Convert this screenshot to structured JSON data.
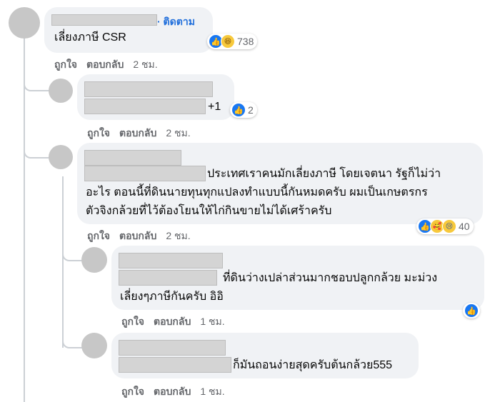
{
  "comments": [
    {
      "follow_label": "· ติดตาม",
      "lines": [
        "เลี่ยงภาษี CSR"
      ],
      "actions": {
        "like": "ถูกใจ",
        "reply": "ตอบกลับ",
        "time": "2 ชม."
      },
      "reaction_icons": [
        "like-icon",
        "haha-icon"
      ],
      "reaction_count": "738",
      "replies": [
        {
          "lines": [
            "+1"
          ],
          "actions": {
            "like": "ถูกใจ",
            "reply": "ตอบกลับ",
            "time": "2 ชม."
          },
          "reaction_icons": [
            "like-icon"
          ],
          "reaction_count": "2"
        },
        {
          "lines": [
            "ประเทศเราคนมักเลี่ยงภาษี โดยเจตนา รัฐก็ไม่ว่า",
            "อะไร ตอนนี้ที่ดินนายทุนทุกแปลงทำแบบนี้กันหมดครับ ผมเป็นเกษตรกร",
            "ตัวจิงกล้วยที่ไว้ต้องโยนให้ไก่กินขายไม่ได้เศร้าครับ"
          ],
          "actions": {
            "like": "ถูกใจ",
            "reply": "ตอบกลับ",
            "time": "2 ชม."
          },
          "reaction_icons": [
            "like-icon",
            "care-icon",
            "sad-icon"
          ],
          "reaction_count": "40",
          "replies": [
            {
              "lines": [
                "ที่ดินว่างเปล่าส่วนมากชอบปลูกกล้วย มะม่วง",
                "เลี่ยงๆภาษีกันครับ อิอิ"
              ],
              "actions": {
                "like": "ถูกใจ",
                "reply": "ตอบกลับ",
                "time": "1 ชม."
              },
              "reaction_icons": [
                "like-icon"
              ]
            },
            {
              "lines": [
                "ก็มันถอนง่ายสุดครับต้นกล้วย555"
              ],
              "actions": {
                "like": "ถูกใจ",
                "reply": "ตอบกลับ",
                "time": "1 ชม."
              }
            }
          ]
        }
      ]
    }
  ]
}
